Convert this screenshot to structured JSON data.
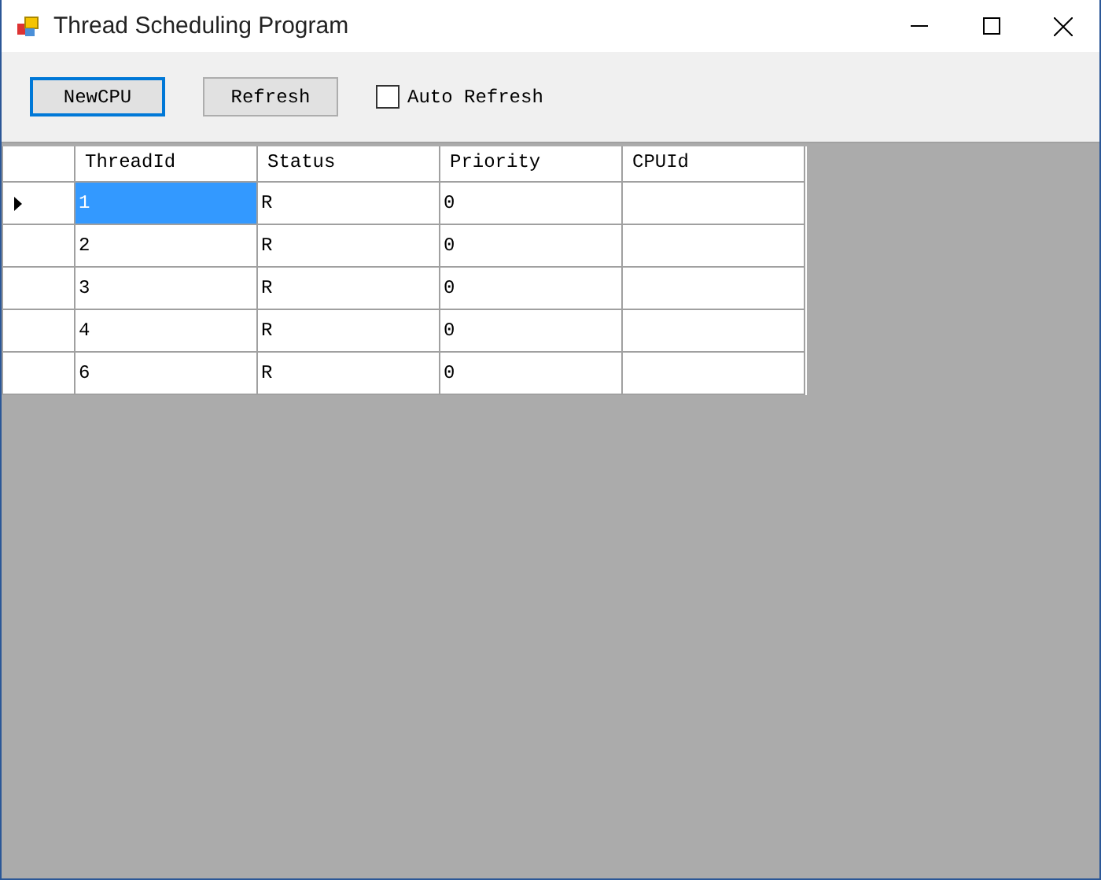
{
  "window": {
    "title": "Thread Scheduling Program"
  },
  "toolbar": {
    "buttons": [
      {
        "label": "NewCPU",
        "focused": true
      },
      {
        "label": "Refresh",
        "focused": false
      }
    ],
    "auto_refresh": {
      "label": "Auto Refresh",
      "checked": false
    }
  },
  "table": {
    "columns": [
      "ThreadId",
      "Status",
      "Priority",
      "CPUId"
    ],
    "rows": [
      {
        "selected": true,
        "cells": [
          "1",
          "R",
          "0"
        ]
      },
      {
        "selected": false,
        "cells": [
          "2",
          "R",
          "0"
        ]
      },
      {
        "selected": false,
        "cells": [
          "3",
          "R",
          "0"
        ]
      },
      {
        "selected": false,
        "cells": [
          "4",
          "R",
          "0"
        ]
      },
      {
        "selected": false,
        "cells": [
          "6",
          "R",
          "0"
        ]
      }
    ]
  }
}
